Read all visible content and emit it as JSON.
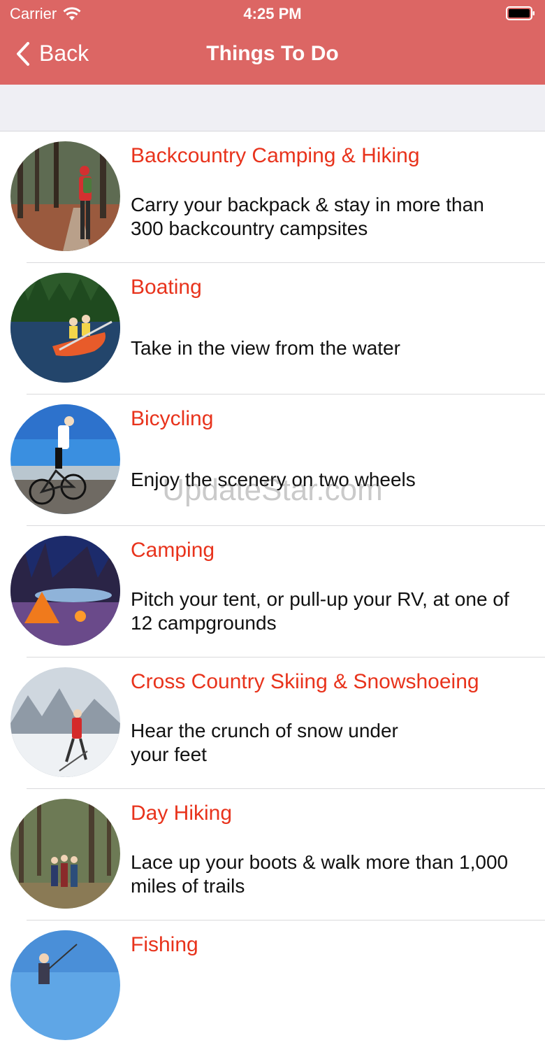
{
  "status": {
    "carrier": "Carrier",
    "time": "4:25 PM"
  },
  "nav": {
    "back_label": "Back",
    "title": "Things To Do"
  },
  "watermark": "UpdateStar.com",
  "items": [
    {
      "title": "Backcountry Camping & Hiking",
      "desc": "Carry your backpack & stay in more than 300 backcountry campsites"
    },
    {
      "title": "Boating",
      "desc": "Take in the view from the water"
    },
    {
      "title": "Bicycling",
      "desc": "Enjoy the scenery on two wheels"
    },
    {
      "title": "Camping",
      "desc": "Pitch your tent, or pull-up your RV, at one of 12 campgrounds"
    },
    {
      "title": "Cross Country Skiing & Snowshoeing",
      "desc": "Hear the crunch of snow under your feet"
    },
    {
      "title": "Day Hiking",
      "desc": "Lace up your boots & walk more than 1,000 miles of trails"
    },
    {
      "title": "Fishing",
      "desc": ""
    }
  ]
}
